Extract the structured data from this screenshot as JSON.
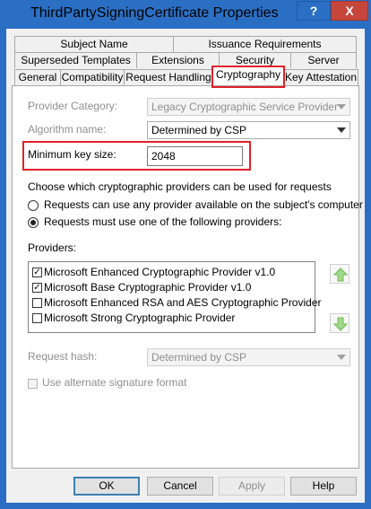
{
  "window": {
    "title": "ThirdPartySigningCertificate Properties",
    "help_button": "?",
    "close_button": "X"
  },
  "tabs": {
    "row1": [
      "Subject Name",
      "Issuance Requirements"
    ],
    "row2": [
      "Superseded Templates",
      "Extensions",
      "Security",
      "Server"
    ],
    "row3": [
      "General",
      "Compatibility",
      "Request Handling",
      "Cryptography",
      "Key Attestation"
    ],
    "selected": "Cryptography"
  },
  "crypto": {
    "provider_category_label": "Provider Category:",
    "provider_category_value": "Legacy Cryptographic Service Provider",
    "algorithm_label": "Algorithm name:",
    "algorithm_value": "Determined by CSP",
    "min_key_size_label": "Minimum key size:",
    "min_key_size_value": "2048",
    "providers_choice_heading": "Choose which cryptographic providers can be used for requests",
    "radio_any_label": "Requests can use any provider available on the subject's computer",
    "radio_must_label": "Requests must use one of the following providers:",
    "providers_label": "Providers:",
    "providers": [
      {
        "name": "Microsoft Enhanced Cryptographic Provider v1.0",
        "checked": true
      },
      {
        "name": "Microsoft Base Cryptographic Provider v1.0",
        "checked": true
      },
      {
        "name": "Microsoft Enhanced RSA and AES Cryptographic Provider",
        "checked": false
      },
      {
        "name": "Microsoft Strong Cryptographic Provider",
        "checked": false
      }
    ],
    "request_hash_label": "Request hash:",
    "request_hash_value": "Determined by CSP",
    "alt_sig_label": "Use alternate signature format",
    "checkmark": "✓"
  },
  "buttons": {
    "ok": "OK",
    "cancel": "Cancel",
    "apply": "Apply",
    "help": "Help"
  },
  "colors": {
    "title_bar": "#2b6fc4",
    "close": "#c7463c",
    "highlight": "#e0202a",
    "arrow_green": "#7cc35a"
  }
}
